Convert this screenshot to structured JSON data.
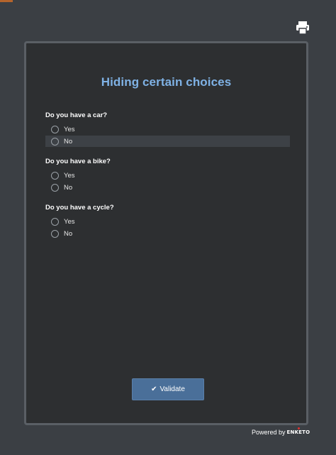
{
  "header": {
    "print_icon": "printer-icon"
  },
  "form": {
    "title": "Hiding certain choices",
    "questions": [
      {
        "label": "Do you have a car?",
        "options": [
          "Yes",
          "No"
        ]
      },
      {
        "label": "Do you have a bike?",
        "options": [
          "Yes",
          "No"
        ]
      },
      {
        "label": "Do you have a cycle?",
        "options": [
          "Yes",
          "No"
        ]
      }
    ],
    "validate_label": "Validate",
    "validate_icon": "check-icon"
  },
  "footer": {
    "powered_by": "Powered by",
    "brand": "ENKETO"
  },
  "colors": {
    "background": "#3b3f44",
    "card": "#2d2f31",
    "title": "#7fb2e5",
    "button": "#4a6f99"
  }
}
